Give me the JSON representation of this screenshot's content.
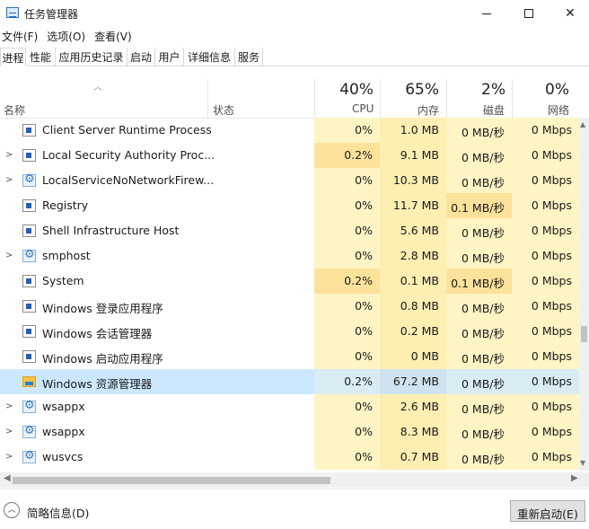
{
  "window": {
    "title": "任务管理器",
    "min_icon": "minimize-icon",
    "max_icon": "maximize-icon",
    "close_glyph": "✕"
  },
  "menu": [
    "文件(F)",
    "选项(O)",
    "查看(V)"
  ],
  "tabs": [
    "进程",
    "性能",
    "应用历史记录",
    "启动",
    "用户",
    "详细信息",
    "服务"
  ],
  "header": {
    "name": "名称",
    "status": "状态",
    "cpu_pct": "40%",
    "cpu_label": "CPU",
    "mem_pct": "65%",
    "mem_label": "内存",
    "disk_pct": "2%",
    "disk_label": "磁盘",
    "net_pct": "0%",
    "net_label": "网络"
  },
  "rows": [
    {
      "name": "Client Server Runtime Process",
      "icon": "app",
      "expand": false,
      "cpu": "0%",
      "mem": "1.0 MB",
      "disk": "0 MB/秒",
      "net": "0 Mbps"
    },
    {
      "name": "Local Security Authority Proc...",
      "icon": "app",
      "expand": true,
      "cpu": "0.2%",
      "mem": "9.1 MB",
      "disk": "0 MB/秒",
      "net": "0 Mbps"
    },
    {
      "name": "LocalServiceNoNetworkFirew...",
      "icon": "gear",
      "expand": true,
      "cpu": "0%",
      "mem": "10.3 MB",
      "disk": "0 MB/秒",
      "net": "0 Mbps"
    },
    {
      "name": "Registry",
      "icon": "app",
      "expand": false,
      "cpu": "0%",
      "mem": "11.7 MB",
      "disk": "0.1 MB/秒",
      "net": "0 Mbps"
    },
    {
      "name": "Shell Infrastructure Host",
      "icon": "app",
      "expand": false,
      "cpu": "0%",
      "mem": "5.6 MB",
      "disk": "0 MB/秒",
      "net": "0 Mbps"
    },
    {
      "name": "smphost",
      "icon": "gear",
      "expand": true,
      "cpu": "0%",
      "mem": "2.8 MB",
      "disk": "0 MB/秒",
      "net": "0 Mbps"
    },
    {
      "name": "System",
      "icon": "app",
      "expand": false,
      "cpu": "0.2%",
      "mem": "0.1 MB",
      "disk": "0.1 MB/秒",
      "net": "0 Mbps"
    },
    {
      "name": "Windows 登录应用程序",
      "icon": "app",
      "expand": false,
      "cpu": "0%",
      "mem": "0.8 MB",
      "disk": "0 MB/秒",
      "net": "0 Mbps"
    },
    {
      "name": "Windows 会话管理器",
      "icon": "app",
      "expand": false,
      "cpu": "0%",
      "mem": "0.2 MB",
      "disk": "0 MB/秒",
      "net": "0 Mbps"
    },
    {
      "name": "Windows 启动应用程序",
      "icon": "app",
      "expand": false,
      "cpu": "0%",
      "mem": "0 MB",
      "disk": "0 MB/秒",
      "net": "0 Mbps"
    },
    {
      "name": "Windows 资源管理器",
      "icon": "folder",
      "expand": false,
      "selected": true,
      "cpu": "0.2%",
      "mem": "67.2 MB",
      "disk": "0 MB/秒",
      "net": "0 Mbps"
    },
    {
      "name": "wsappx",
      "icon": "gear",
      "expand": true,
      "cpu": "0%",
      "mem": "2.6 MB",
      "disk": "0 MB/秒",
      "net": "0 Mbps"
    },
    {
      "name": "wsappx",
      "icon": "gear",
      "expand": true,
      "cpu": "0%",
      "mem": "8.3 MB",
      "disk": "0 MB/秒",
      "net": "0 Mbps"
    },
    {
      "name": "wusvcs",
      "icon": "gear",
      "expand": true,
      "cpu": "0%",
      "mem": "0.7 MB",
      "disk": "0 MB/秒",
      "net": "0 Mbps"
    }
  ],
  "footer": {
    "fewer_details": "简略信息(D)",
    "restart": "重新启动(E)"
  }
}
